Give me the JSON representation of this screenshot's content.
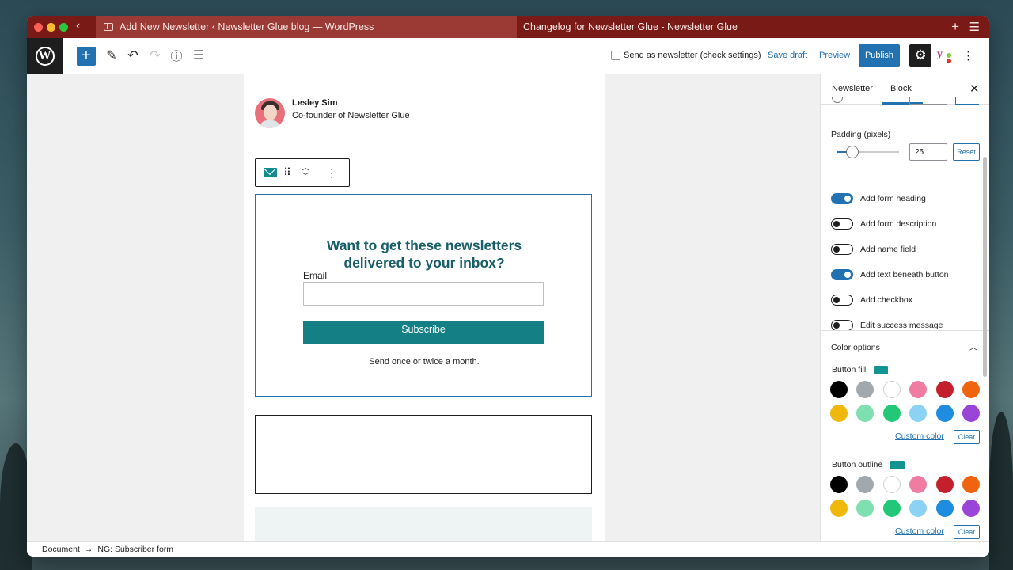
{
  "browser": {
    "active_tab": "Add New Newsletter ‹ Newsletter Glue blog — WordPress",
    "second_tab": "Changelog for Newsletter Glue - Newsletter Glue"
  },
  "toolbar": {
    "send_as_newsletter": "Send as newsletter",
    "check_settings": "(check settings)",
    "save_draft": "Save draft",
    "preview": "Preview",
    "publish": "Publish"
  },
  "author": {
    "name": "Lesley Sim",
    "role": "Co-founder of Newsletter Glue"
  },
  "form": {
    "heading_line1": "Want to get these newsletters",
    "heading_line2": "delivered to your inbox?",
    "email_label": "Email",
    "button": "Subscribe",
    "note": "Send once or twice a month.",
    "heading_color": "#175e68",
    "button_color": "#147f85"
  },
  "sidebar": {
    "tab_newsletter": "Newsletter",
    "tab_block": "Block",
    "padding_label": "Padding (pixels)",
    "padding_value": "25",
    "reset": "Reset",
    "toggles": [
      {
        "label": "Add form heading",
        "on": true
      },
      {
        "label": "Add form description",
        "on": false
      },
      {
        "label": "Add name field",
        "on": false
      },
      {
        "label": "Add text beneath button",
        "on": true
      },
      {
        "label": "Add checkbox",
        "on": false
      },
      {
        "label": "Edit success message",
        "on": false
      }
    ],
    "color_options": "Color options",
    "button_fill": "Button fill",
    "button_outline": "Button outline",
    "custom_color": "Custom color",
    "clear": "Clear",
    "palette": [
      "#000000",
      "#a2a9ae",
      "#ffffff",
      "#f07ca2",
      "#c41f2d",
      "#f0640f",
      "#f0b80a",
      "#7ee0b0",
      "#22c875",
      "#8cd2f5",
      "#1e8de0",
      "#9b44d8"
    ]
  },
  "footer": {
    "document": "Document",
    "block": "NG: Subscriber form"
  }
}
